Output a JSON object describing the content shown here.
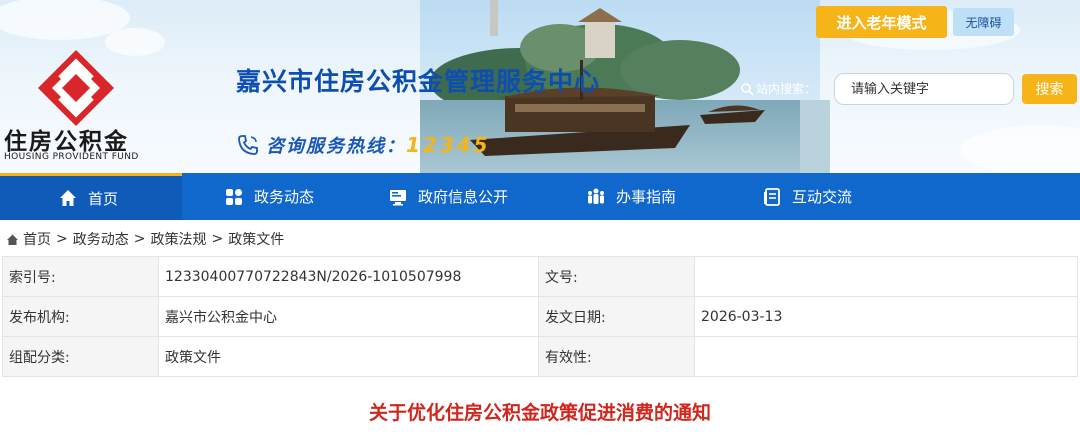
{
  "header": {
    "logo_cn": "住房公积金",
    "logo_en": "HOUSING PROVIDENT FUND",
    "site_title": "嘉兴市住房公积金管理服务中心",
    "hotline_label": "咨询服务热线：",
    "hotline_number": "12345",
    "elder_mode_label": "进入老年模式",
    "accessible_label": "无障碍",
    "search_label": "站内搜索：",
    "search_placeholder": "请输入关键字",
    "search_button": "搜索"
  },
  "nav": {
    "items": [
      {
        "label": "首页",
        "icon": "home-icon"
      },
      {
        "label": "政务动态",
        "icon": "grid-icon"
      },
      {
        "label": "政府信息公开",
        "icon": "monitor-icon"
      },
      {
        "label": "办事指南",
        "icon": "people-icon"
      },
      {
        "label": "互动交流",
        "icon": "document-icon"
      }
    ]
  },
  "breadcrumb": [
    "首页",
    "政务动态",
    "政策法规",
    "政策文件"
  ],
  "info": {
    "index_label": "索引号:",
    "index_value": "12330400770722843N/2026-1010507998",
    "doc_no_label": "文号:",
    "doc_no_value": "",
    "issuer_label": "发布机构:",
    "issuer_value": "嘉兴市公积金中心",
    "date_label": "发文日期:",
    "date_value": "2026-03-13",
    "category_label": "组配分类:",
    "category_value": "政策文件",
    "validity_label": "有效性:",
    "validity_value": ""
  },
  "article_title": "关于优化住房公积金政策促进消费的通知",
  "colors": {
    "nav_blue": "#1168cc",
    "accent_orange": "#f6b418",
    "title_blue": "#0d4fb0",
    "article_red": "#d0261d"
  }
}
